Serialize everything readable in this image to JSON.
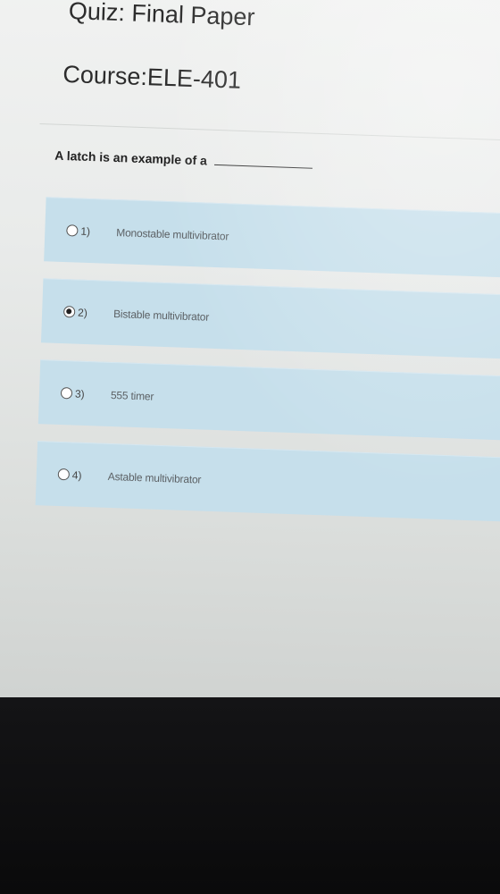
{
  "quiz": {
    "title": "Quiz: Final Paper",
    "course": "Course:ELE-401"
  },
  "question": {
    "text": "A latch is an example of a"
  },
  "options": [
    {
      "number": "1)",
      "text": "Monostable multivibrator",
      "selected": false
    },
    {
      "number": "2)",
      "text": "Bistable multivibrator",
      "selected": true
    },
    {
      "number": "3)",
      "text": "555 timer",
      "selected": false
    },
    {
      "number": "4)",
      "text": "Astable multivibrator",
      "selected": false
    }
  ],
  "colors": {
    "option_background": "#c6dfeb",
    "page_background": "#ececeb",
    "bezel": "#0b0b0d"
  }
}
